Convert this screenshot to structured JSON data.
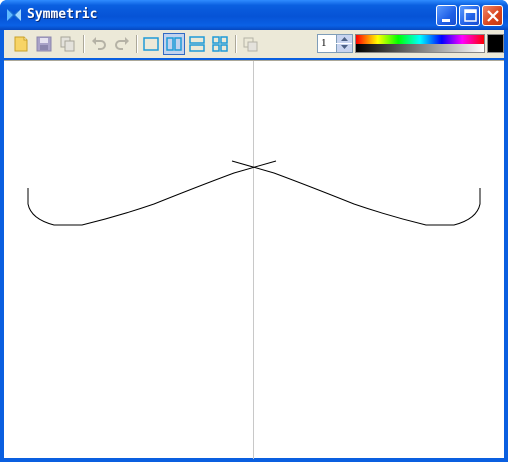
{
  "window": {
    "title": "Symmetric",
    "title_color": "#ffffff",
    "frame_color": "#0a5fe0"
  },
  "title_buttons": [
    {
      "name": "minimize",
      "icon": "minimize-icon"
    },
    {
      "name": "maximize",
      "icon": "maximize-icon"
    },
    {
      "name": "close",
      "icon": "close-icon"
    }
  ],
  "toolbar": {
    "tools": [
      {
        "name": "new",
        "icon": "new-document-icon",
        "enabled": true
      },
      {
        "name": "save",
        "icon": "save-icon",
        "enabled": false
      },
      {
        "name": "copy",
        "icon": "copy-icon",
        "enabled": false
      },
      {
        "name": "undo",
        "icon": "undo-icon",
        "enabled": false
      },
      {
        "name": "redo",
        "icon": "redo-icon",
        "enabled": false
      },
      {
        "name": "symmetry-none",
        "icon": "single-pane-icon",
        "active": false
      },
      {
        "name": "symmetry-vertical",
        "icon": "vertical-split-icon",
        "active": true
      },
      {
        "name": "symmetry-horizontal",
        "icon": "horizontal-split-icon",
        "active": false
      },
      {
        "name": "symmetry-quad",
        "icon": "quad-split-icon",
        "active": false
      },
      {
        "name": "overlay",
        "icon": "overlay-icon",
        "enabled": false
      }
    ],
    "line_width": "1",
    "current_color": "#000000",
    "accent_color": "#1e9bd7"
  }
}
